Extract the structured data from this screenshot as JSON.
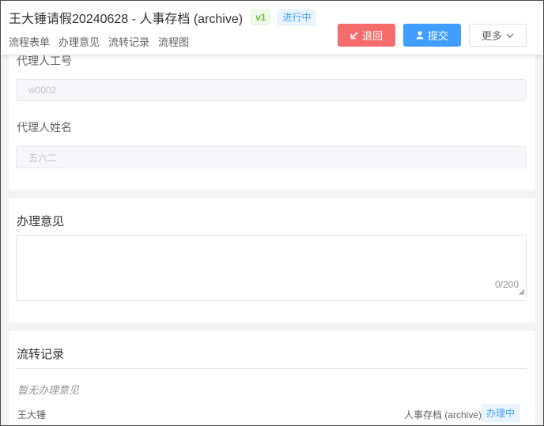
{
  "header": {
    "title": "王大锤请假20240628 - 人事存档 (archive)",
    "version_tag": "v1",
    "status_tag": "进行中",
    "tabs": [
      {
        "label": "流程表单"
      },
      {
        "label": "办理意见"
      },
      {
        "label": "流转记录"
      },
      {
        "label": "流程图"
      }
    ],
    "actions": {
      "return_label": "退回",
      "submit_label": "提交",
      "more_label": "更多"
    }
  },
  "form": {
    "agent_id_label": "代理人工号",
    "agent_id_value": "w0002",
    "agent_name_label": "代理人姓名",
    "agent_name_value": "五六二"
  },
  "opinion": {
    "title": "办理意见",
    "value": "",
    "counter": "0/200"
  },
  "records": {
    "title": "流转记录",
    "empty_text": "暂无办理意见",
    "items": [
      {
        "user": "王大锤",
        "node": "人事存档 (archive)",
        "status": "办理中"
      }
    ]
  },
  "colors": {
    "danger": "#f56c6c",
    "primary": "#409eff",
    "success": "#67c23a"
  }
}
